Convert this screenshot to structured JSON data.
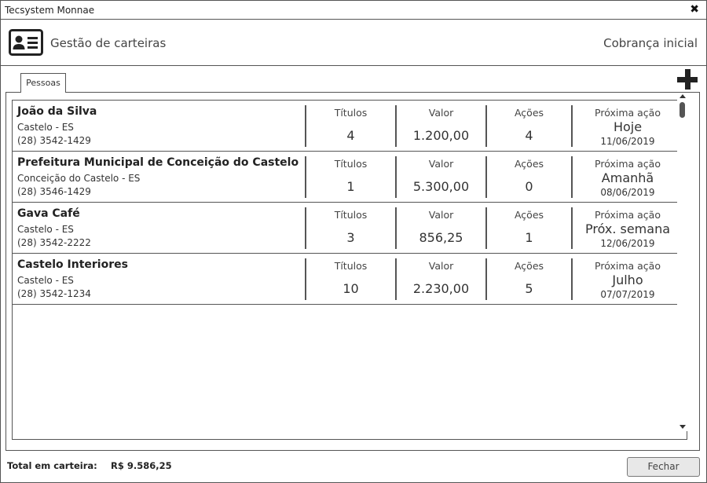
{
  "window": {
    "title": "Tecsystem Monnae",
    "close_glyph": "✖"
  },
  "header": {
    "icon": "id-card-icon",
    "title": "Gestão de carteiras",
    "cobranca_link": "Cobrança inicial"
  },
  "tabs": [
    {
      "label": "Pessoas",
      "active": true
    }
  ],
  "add_button": {
    "icon": "plus-icon"
  },
  "columns": {
    "titulos": "Títulos",
    "valor": "Valor",
    "acoes": "Ações",
    "proxima": "Próxima ação"
  },
  "rows": [
    {
      "name": "João da Silva",
      "city": "Castelo - ES",
      "phone": "(28) 3542-1429",
      "titulos": "4",
      "valor": "1.200,00",
      "acoes": "4",
      "proxima_acao": "Hoje",
      "data": "11/06/2019"
    },
    {
      "name": "Prefeitura Municipal de Conceição do Castelo",
      "city": "Conceição do Castelo - ES",
      "phone": "(28) 3546-1429",
      "titulos": "1",
      "valor": "5.300,00",
      "acoes": "0",
      "proxima_acao": "Amanhã",
      "data": "08/06/2019"
    },
    {
      "name": "Gava Café",
      "city": "Castelo - ES",
      "phone": "(28) 3542-2222",
      "titulos": "3",
      "valor": "856,25",
      "acoes": "1",
      "proxima_acao": "Próx. semana",
      "data": "12/06/2019"
    },
    {
      "name": "Castelo Interiores",
      "city": "Castelo - ES",
      "phone": "(28) 3542-1234",
      "titulos": "10",
      "valor": "2.230,00",
      "acoes": "5",
      "proxima_acao": "Julho",
      "data": "07/07/2019"
    }
  ],
  "footer": {
    "total_label": "Total em carteira:",
    "total_value": "R$ 9.586,25",
    "close_button": "Fechar"
  },
  "colors": {
    "border": "#555555",
    "button_bg": "#e8e8e8",
    "text": "#333333"
  }
}
